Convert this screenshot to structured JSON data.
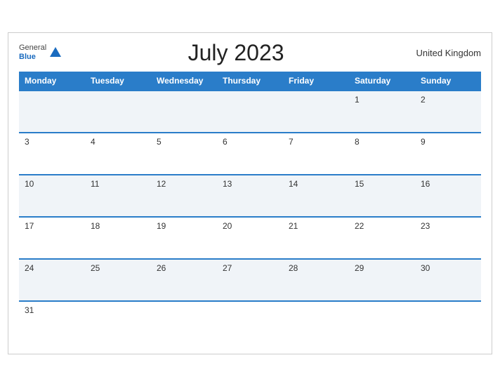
{
  "header": {
    "title": "July 2023",
    "country": "United Kingdom",
    "logo_general": "General",
    "logo_blue": "Blue"
  },
  "days_of_week": [
    "Monday",
    "Tuesday",
    "Wednesday",
    "Thursday",
    "Friday",
    "Saturday",
    "Sunday"
  ],
  "weeks": [
    [
      "",
      "",
      "",
      "",
      "",
      "1",
      "2"
    ],
    [
      "3",
      "4",
      "5",
      "6",
      "7",
      "8",
      "9"
    ],
    [
      "10",
      "11",
      "12",
      "13",
      "14",
      "15",
      "16"
    ],
    [
      "17",
      "18",
      "19",
      "20",
      "21",
      "22",
      "23"
    ],
    [
      "24",
      "25",
      "26",
      "27",
      "28",
      "29",
      "30"
    ],
    [
      "31",
      "",
      "",
      "",
      "",
      "",
      ""
    ]
  ]
}
